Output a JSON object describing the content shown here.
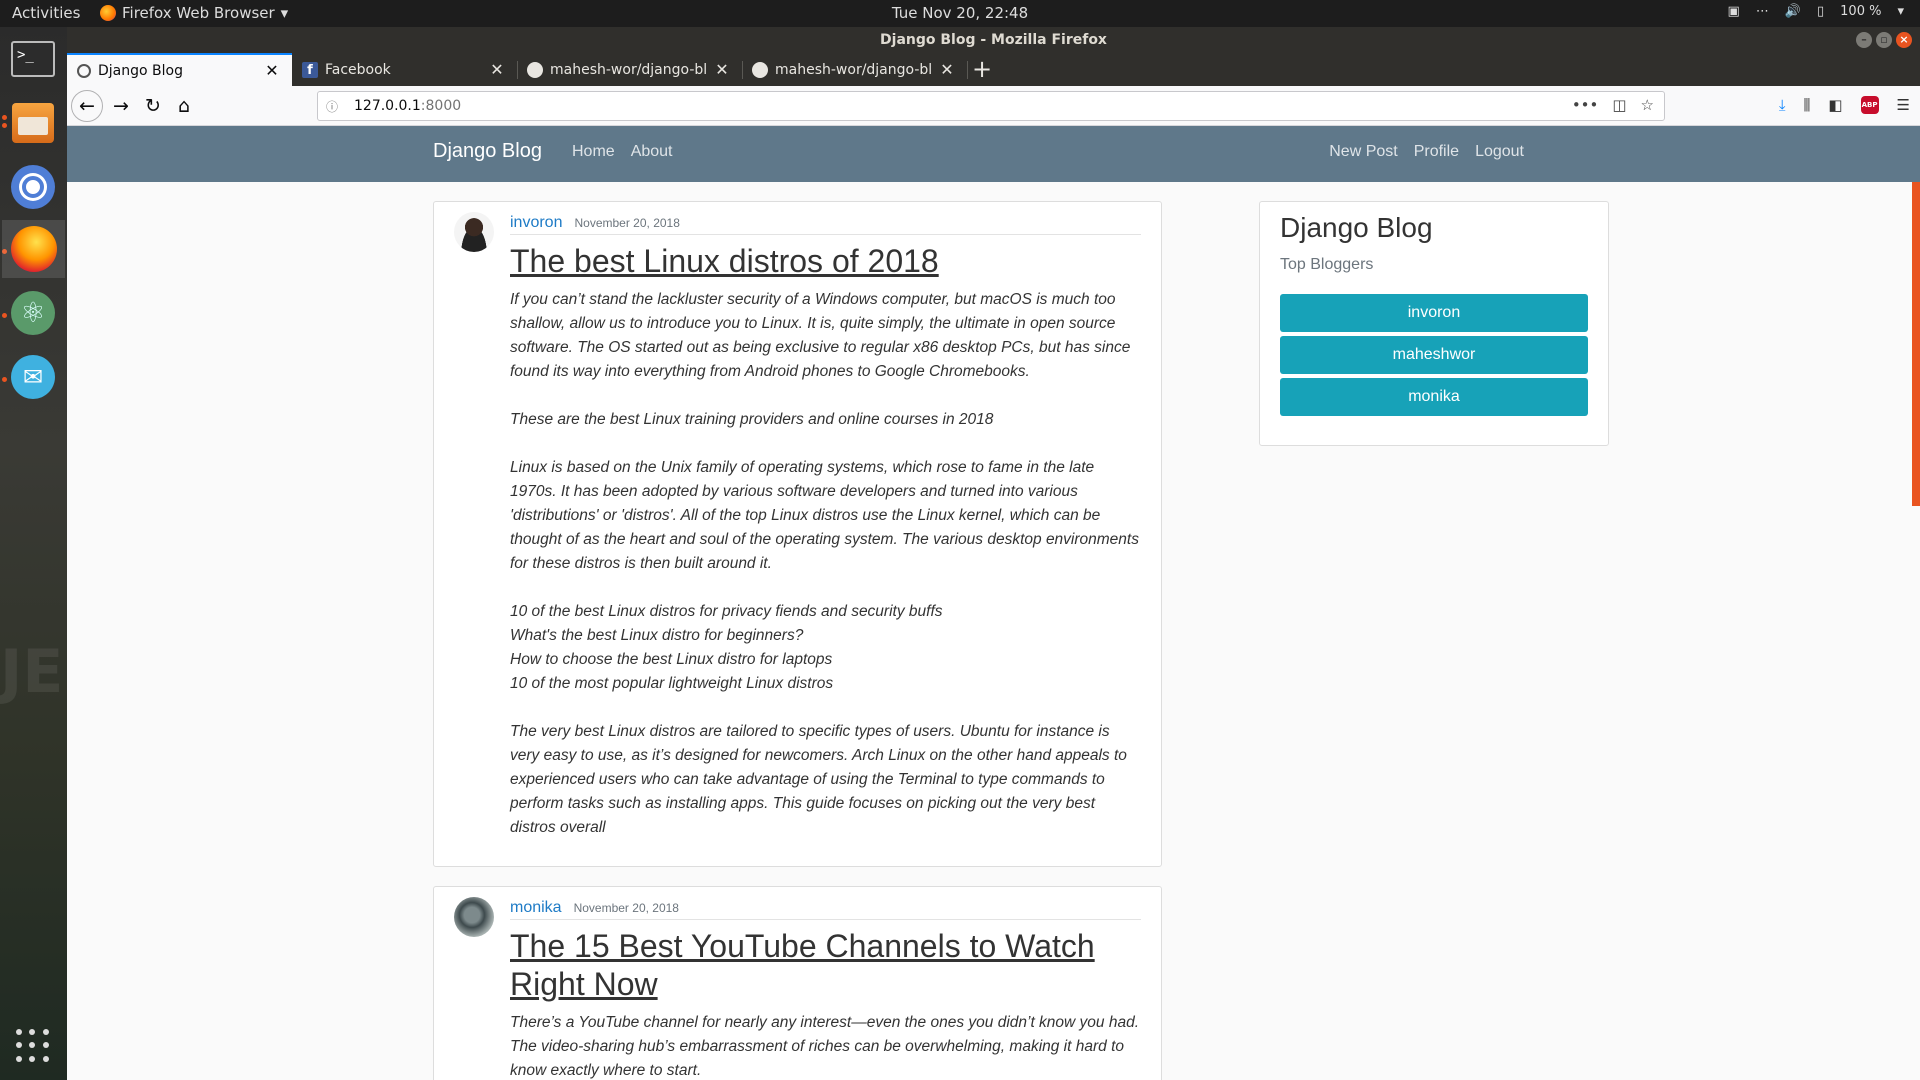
{
  "topbar": {
    "activities": "Activities",
    "app_name": "Firefox Web Browser",
    "clock": "Tue Nov 20, 22:48",
    "battery": "100 %"
  },
  "dock": {
    "items": [
      "Terminal",
      "Files",
      "Chromium",
      "Firefox",
      "Atom",
      "Mail",
      "Show Applications"
    ]
  },
  "window": {
    "title": "Django Blog - Mozilla Firefox"
  },
  "tabs": [
    {
      "title": "Django Blog",
      "active": true
    },
    {
      "title": "Facebook",
      "active": false
    },
    {
      "title": "mahesh-wor/django-blog",
      "active": false
    },
    {
      "title": "mahesh-wor/django-blog",
      "active": false
    }
  ],
  "urlbar": {
    "host": "127.0.0.1",
    "port": ":8000"
  },
  "site": {
    "brand": "Django Blog",
    "nav_left": [
      "Home",
      "About"
    ],
    "nav_right": [
      "New Post",
      "Profile",
      "Logout"
    ]
  },
  "posts": [
    {
      "author": "invoron",
      "date": "November 20, 2018",
      "title": "The best Linux distros of 2018",
      "paragraphs": [
        "If you can’t stand the lackluster security of a Windows computer, but macOS is much too shallow, allow us to introduce you to Linux. It is, quite simply, the ultimate in open source software. The OS started out as being exclusive to regular x86 desktop PCs, but has since found its way into everything from Android phones to Google Chromebooks.",
        "These are the best Linux training providers and online courses in 2018",
        "Linux is based on the Unix family of operating systems, which rose to fame in the late 1970s. It has been adopted by various software developers and turned into various 'distributions' or 'distros'. All of the top Linux distros use the Linux kernel, which can be thought of as the heart and soul of the operating system. The various desktop environments for these distros is then built around it.",
        "10 of the best Linux distros for privacy fiends and security buffs\nWhat's the best Linux distro for beginners?\nHow to choose the best Linux distro for laptops\n10 of the most popular lightweight Linux distros",
        "The very best Linux distros are tailored to specific types of users. Ubuntu for instance is very easy to use, as it’s designed for newcomers. Arch Linux on the other hand appeals to experienced users who can take advantage of using the Terminal to type commands to perform tasks such as installing apps. This guide focuses on picking out the very best distros overall"
      ]
    },
    {
      "author": "monika",
      "date": "November 20, 2018",
      "title": "The 15 Best YouTube Channels to Watch Right Now",
      "paragraphs": [
        "There’s a YouTube channel for nearly any interest—even the ones you didn’t know you had. The video-sharing hub’s embarrassment of riches can be overwhelming, making it hard to know exactly where to start."
      ]
    }
  ],
  "sidebar": {
    "title": "Django Blog",
    "subtitle": "Top Bloggers",
    "bloggers": [
      "invoron",
      "maheshwor",
      "monika"
    ]
  }
}
